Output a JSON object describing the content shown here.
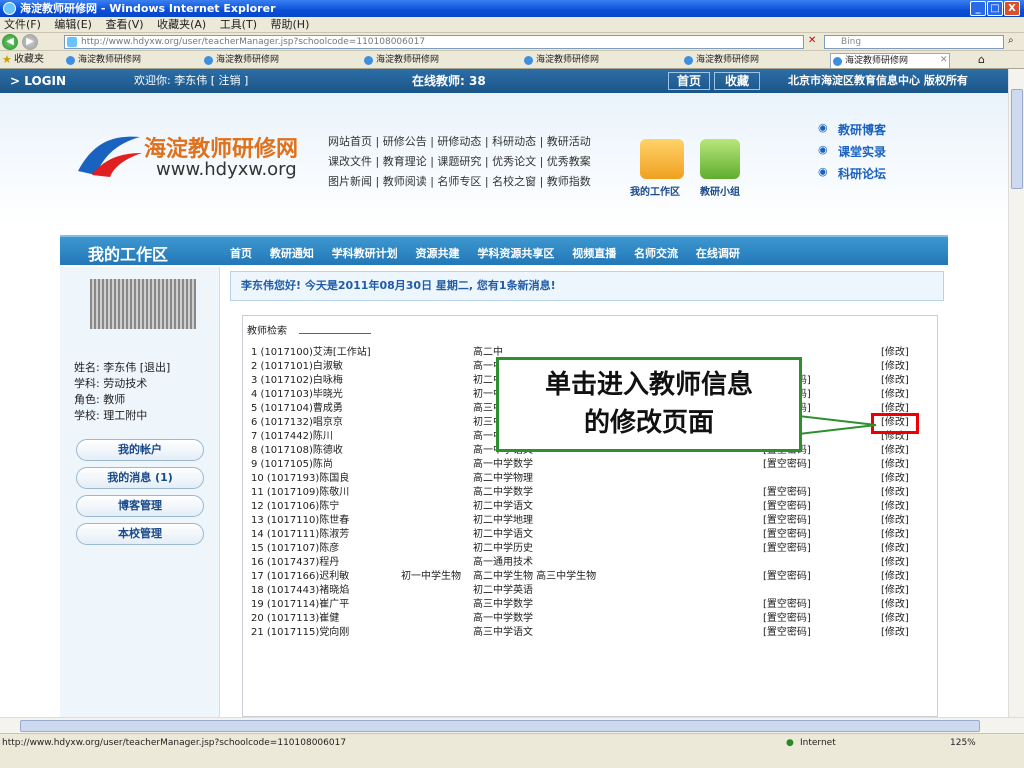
{
  "window": {
    "title": "海淀教师研修网 - Windows Internet Explorer",
    "min_label": "_",
    "max_label": "□",
    "close_label": "X"
  },
  "menu": [
    "文件(F)",
    "编辑(E)",
    "查看(V)",
    "收藏夹(A)",
    "工具(T)",
    "帮助(H)"
  ],
  "address": {
    "url": "http://www.hdyxw.org/user/teacherManager.jsp?schoolcode=110108006017",
    "search_placeholder": "Bing"
  },
  "favorites": {
    "label": "收藏夹",
    "tabs": [
      "海淀教师研修网",
      "海淀教师研修网",
      "海淀教师研修网",
      "海淀教师研修网",
      "海淀教师研修网",
      "海淀教师研修网"
    ]
  },
  "topstrip": {
    "login": "> LOGIN",
    "welcome": "欢迎你: 李东伟 [ 注销 ]",
    "online": "在线教师: 38",
    "home": "首页",
    "fav": "收藏",
    "copyright": "北京市海淀区教育信息中心 版权所有"
  },
  "banner": {
    "site_name": "海淀教师研修网",
    "site_url": "www.hdyxw.org",
    "link_rows": [
      "网站首页 | 研修公告 | 研修动态 | 科研动态 | 教研活动",
      "课改文件 | 教育理论 | 课题研究 | 优秀论文 | 优秀教案",
      "图片新闻 | 教师阅读 | 名师专区 | 名校之窗 | 教师指数"
    ],
    "workspace_label": "我的工作区",
    "group_label": "教研小组",
    "right_links": [
      "教研博客",
      "课堂实录",
      "科研论坛"
    ]
  },
  "nav": {
    "title": "我的工作区",
    "items": [
      "首页",
      "教研通知",
      "学科教研计划",
      "资源共建",
      "学科资源共享区",
      "视频直播",
      "名师交流",
      "在线调研"
    ]
  },
  "profile": {
    "name": "姓名:  李东伟 [退出]",
    "subject": "学科:  劳动技术",
    "role": "角色:  教师",
    "school": "学校:  理工附中"
  },
  "side_buttons": [
    "我的帐户",
    "我的消息 (1)",
    "博客管理",
    "本校管理"
  ],
  "welcome_msg": "李东伟您好! 今天是2011年08月30日 星期二, 您有1条新消息!",
  "list": {
    "search_label": "教师检索",
    "reset_label": "[置空密码]",
    "edit_label": "[修改]",
    "rows": [
      {
        "idx": "1 (1017100)艾涛[工作站]",
        "extra": "",
        "subj": "高二中",
        "reset": false
      },
      {
        "idx": "2 (1017101)白淑敏",
        "extra": "",
        "subj": "高一中",
        "reset": false
      },
      {
        "idx": "3 (1017102)白咏梅",
        "extra": "",
        "subj": "初二中学语文",
        "reset": true
      },
      {
        "idx": "4 (1017103)毕晓光",
        "extra": "",
        "subj": "初一中学生物",
        "reset": true
      },
      {
        "idx": "5 (1017104)曹成勇",
        "extra": "",
        "subj": "高三中学物理",
        "reset": true
      },
      {
        "idx": "6 (1017132)唱京京",
        "extra": "",
        "subj": "初三中学英语",
        "reset": true
      },
      {
        "idx": "7 (1017442)陈川",
        "extra": "",
        "subj": "高一中学英语",
        "reset": false
      },
      {
        "idx": "8 (1017108)陈德收",
        "extra": "",
        "subj": "高一中学语文",
        "reset": true
      },
      {
        "idx": "9 (1017105)陈尚",
        "extra": "",
        "subj": "高一中学数学",
        "reset": true
      },
      {
        "idx": "10 (1017193)陈国良",
        "extra": "",
        "subj": "高二中学物理",
        "reset": false
      },
      {
        "idx": "11 (1017109)陈敬川",
        "extra": "",
        "subj": "高二中学数学",
        "reset": true
      },
      {
        "idx": "12 (1017106)陈宁",
        "extra": "",
        "subj": "初二中学语文",
        "reset": true
      },
      {
        "idx": "13 (1017110)陈世春",
        "extra": "",
        "subj": "初二中学地理",
        "reset": true
      },
      {
        "idx": "14 (1017111)陈淑芳",
        "extra": "",
        "subj": "初二中学语文",
        "reset": true
      },
      {
        "idx": "15 (1017107)陈彦",
        "extra": "",
        "subj": "初二中学历史",
        "reset": true
      },
      {
        "idx": "16 (1017437)程丹",
        "extra": "",
        "subj": "高一通用技术",
        "reset": false
      },
      {
        "idx": "17 (1017166)迟利敏",
        "extra": "初一中学生物",
        "subj": "高二中学生物 高三中学生物",
        "reset": true
      },
      {
        "idx": "18 (1017443)褚晓焰",
        "extra": "",
        "subj": "初二中学英语",
        "reset": false
      },
      {
        "idx": "19 (1017114)崔广平",
        "extra": "",
        "subj": "高三中学数学",
        "reset": true
      },
      {
        "idx": "20 (1017113)崔健",
        "extra": "",
        "subj": "高一中学数学",
        "reset": true
      },
      {
        "idx": "21 (1017115)党向刚",
        "extra": "",
        "subj": "高三中学语文",
        "reset": true
      }
    ]
  },
  "callout": {
    "line1": "单击进入教师信息",
    "line2": "的修改页面"
  },
  "status": {
    "url": "http://www.hdyxw.org/user/teacherManager.jsp?schoolcode=110108006017",
    "zone": "Internet",
    "zoom": "125%"
  },
  "colors": {
    "accent": "#2378b8",
    "callout_border": "#2e8f2e",
    "highlight": "#e00000"
  }
}
